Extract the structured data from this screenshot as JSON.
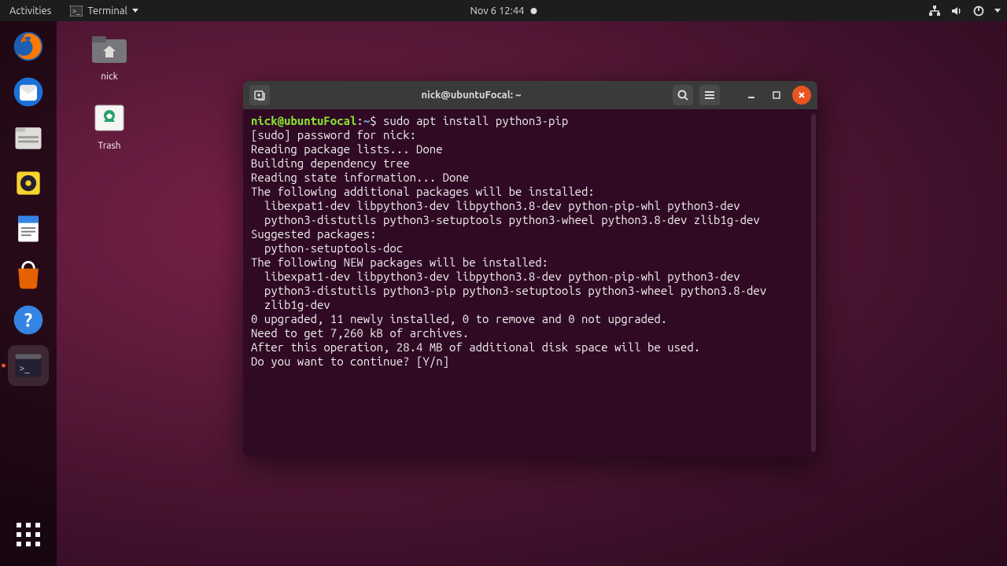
{
  "topbar": {
    "activities": "Activities",
    "app_name": "Terminal",
    "datetime": "Nov 6  12:44"
  },
  "desktop": {
    "home_label": "nick",
    "trash_label": "Trash"
  },
  "terminal": {
    "title": "nick@ubuntuFocal: ~",
    "prompt_user": "nick@ubuntuFocal",
    "prompt_sep1": ":",
    "prompt_path": "~",
    "prompt_sep2": "$ ",
    "command": "sudo apt install python3-pip",
    "lines": [
      "[sudo] password for nick:",
      "Reading package lists... Done",
      "Building dependency tree",
      "Reading state information... Done",
      "The following additional packages will be installed:",
      "  libexpat1-dev libpython3-dev libpython3.8-dev python-pip-whl python3-dev",
      "  python3-distutils python3-setuptools python3-wheel python3.8-dev zlib1g-dev",
      "Suggested packages:",
      "  python-setuptools-doc",
      "The following NEW packages will be installed:",
      "  libexpat1-dev libpython3-dev libpython3.8-dev python-pip-whl python3-dev",
      "  python3-distutils python3-pip python3-setuptools python3-wheel python3.8-dev",
      "  zlib1g-dev",
      "0 upgraded, 11 newly installed, 0 to remove and 0 not upgraded.",
      "Need to get 7,260 kB of archives.",
      "After this operation, 28.4 MB of additional disk space will be used.",
      "Do you want to continue? [Y/n]"
    ]
  }
}
